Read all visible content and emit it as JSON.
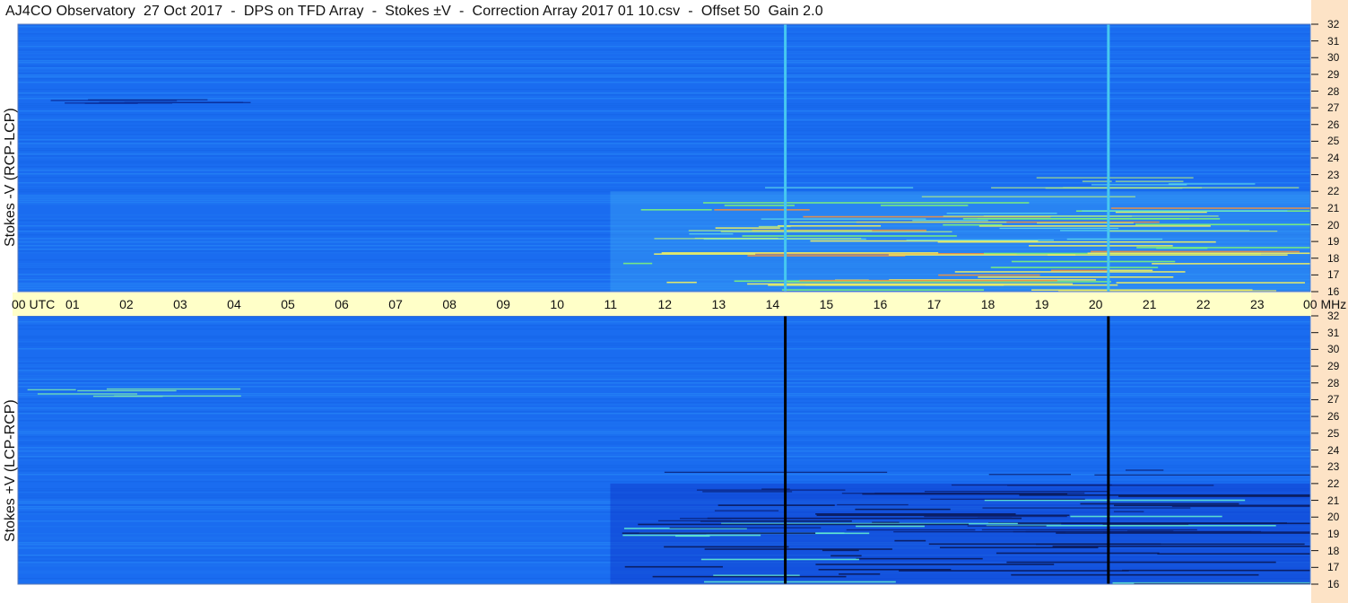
{
  "header": {
    "title": "AJ4CO Observatory  27 Oct 2017  -  DPS on TFD Array  -  Stokes ±V  -  Correction Array 2017 01 10.csv  -  Offset 50  Gain 2.0"
  },
  "colors": {
    "background_blue": "#1a6cf0",
    "bright_blue": "#2a8cf8",
    "deep_blue": "#0c34c8",
    "time_band": "#ffffc8",
    "right_strip": "#fde3c6",
    "hot_green": "#7cf27a",
    "hot_yellow": "#f0f060",
    "hot_orange": "#f09040"
  },
  "chart_data": [
    {
      "type": "heatmap",
      "title": "",
      "ylabel": "Stokes -V (RCP-LCP)",
      "xlabel": "UTC",
      "xlim": [
        0,
        24
      ],
      "ylim": [
        16,
        32
      ],
      "y_unit": "MHz",
      "x_tick_labels": [
        "00 UTC",
        "01",
        "02",
        "03",
        "04",
        "05",
        "06",
        "07",
        "08",
        "09",
        "10",
        "11",
        "12",
        "13",
        "14",
        "15",
        "16",
        "17",
        "18",
        "19",
        "20",
        "21",
        "22",
        "23",
        "00 MHz"
      ],
      "y_tick_labels": [
        "32",
        "31",
        "30",
        "29",
        "28",
        "27",
        "26",
        "25",
        "24",
        "23",
        "22",
        "21",
        "20",
        "19",
        "18",
        "17",
        "16"
      ],
      "noise_lines_hour": [
        14.25,
        20.25
      ],
      "activity_window_hours": [
        11,
        24
      ],
      "strongest_band_mhz": [
        16,
        19
      ]
    },
    {
      "type": "heatmap",
      "title": "",
      "ylabel": "Stokes +V (LCP-RCP)",
      "xlabel": "UTC",
      "xlim": [
        0,
        24
      ],
      "ylim": [
        16,
        32
      ],
      "y_unit": "MHz",
      "y_tick_labels": [
        "32",
        "31",
        "30",
        "29",
        "28",
        "27",
        "26",
        "25",
        "24",
        "23",
        "22",
        "21",
        "20",
        "19",
        "18",
        "17",
        "16"
      ],
      "noise_lines_hour": [
        14.25,
        20.25
      ],
      "activity_window_hours": [
        11,
        24
      ],
      "strongest_band_mhz": [
        16,
        19
      ]
    }
  ]
}
